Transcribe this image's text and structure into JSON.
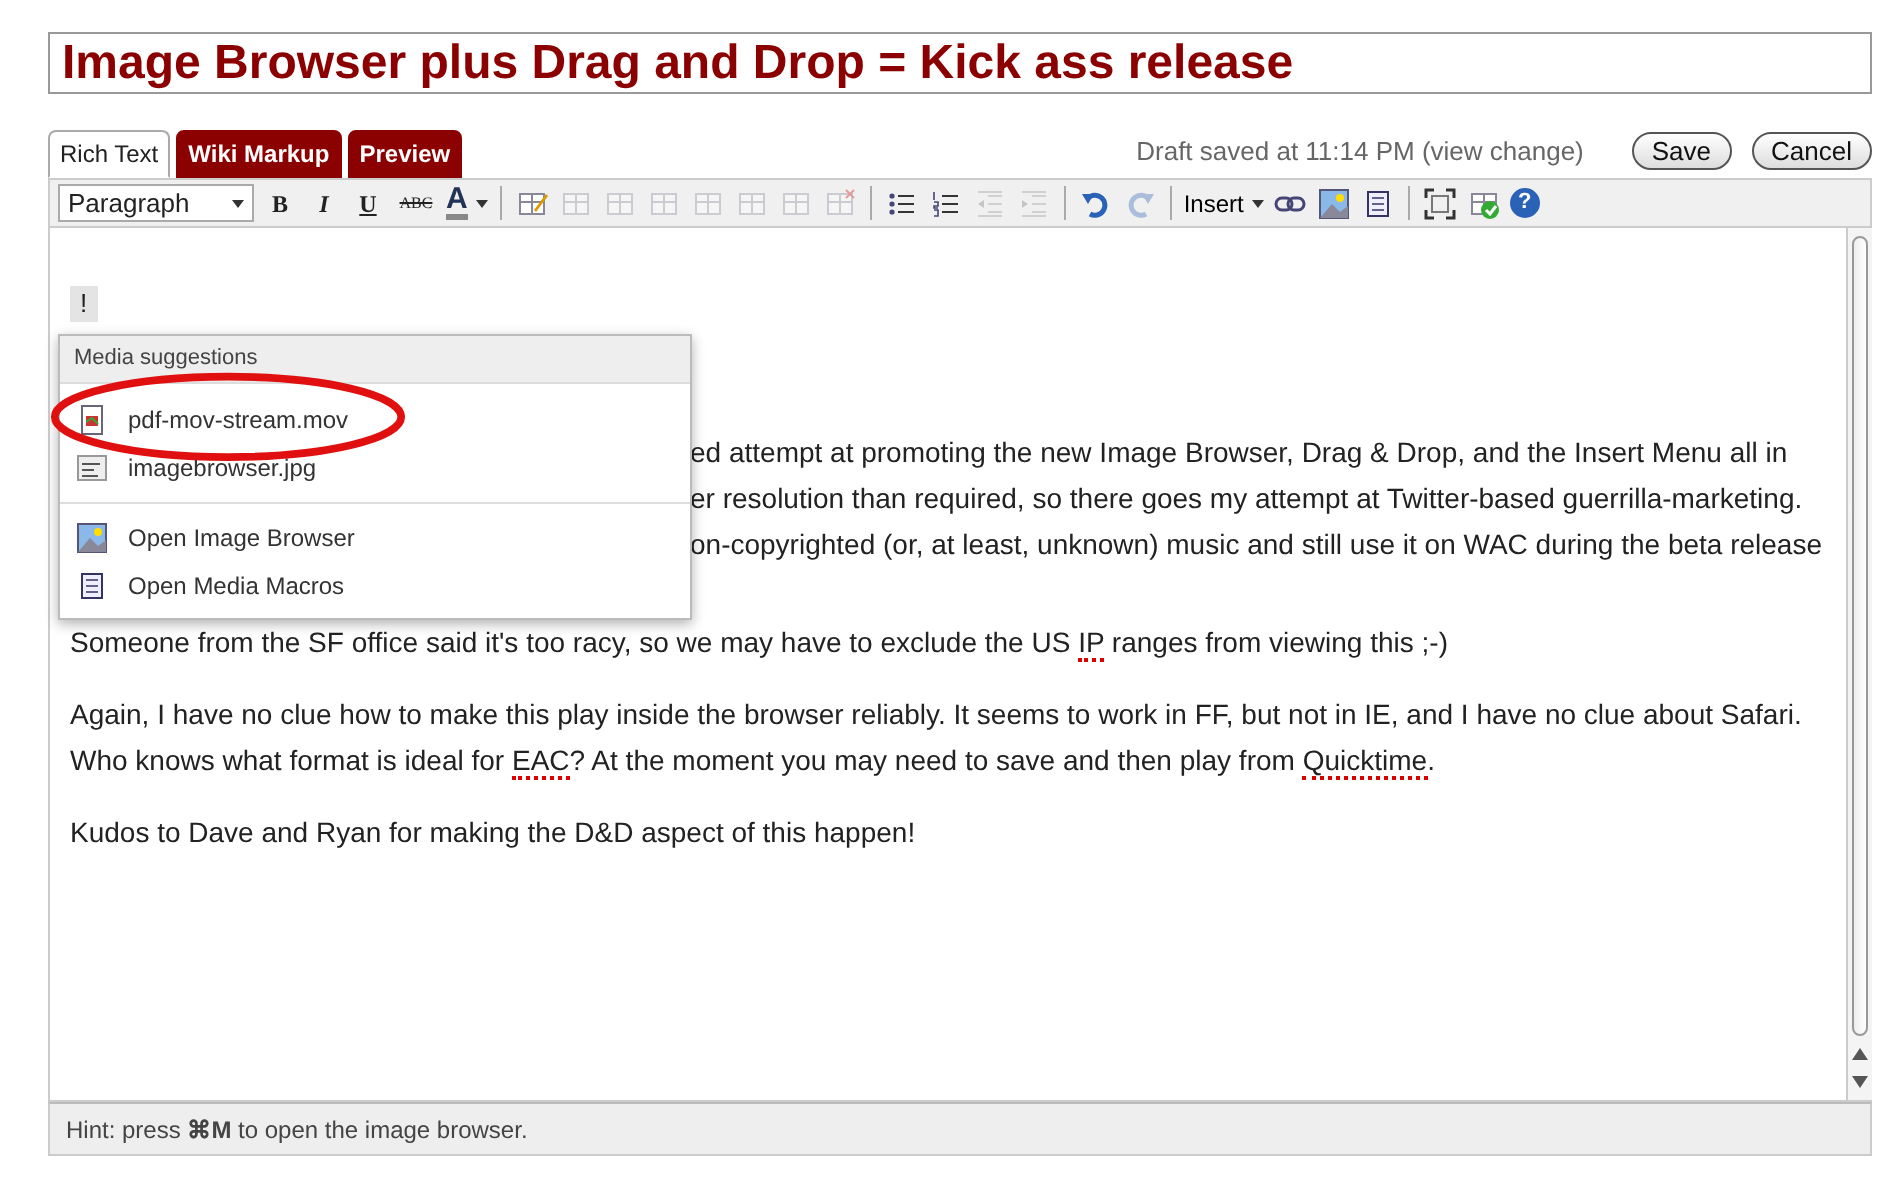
{
  "title": "Image Browser plus Drag and Drop = Kick ass release",
  "tabs": [
    {
      "label": "Rich Text",
      "selected": true
    },
    {
      "label": "Wiki Markup",
      "selected": false
    },
    {
      "label": "Preview",
      "selected": false
    }
  ],
  "draft_status": "Draft saved at 11:14 PM (view change)",
  "buttons": [
    "Save",
    "Cancel"
  ],
  "toolbar": [
    {
      "kind": "select",
      "label": "Paragraph"
    },
    {
      "kind": "bold",
      "label": "B"
    },
    {
      "kind": "italic",
      "label": "I"
    },
    {
      "kind": "underline",
      "label": "U"
    },
    {
      "kind": "strike",
      "label": "ABC"
    },
    {
      "kind": "color",
      "label": "A"
    },
    {
      "kind": "separator"
    },
    {
      "kind": "icon",
      "disabled": false
    },
    {
      "kind": "icon",
      "disabled": true
    },
    {
      "kind": "icon",
      "disabled": true
    },
    {
      "kind": "icon",
      "disabled": true
    },
    {
      "kind": "icon",
      "disabled": true
    },
    {
      "kind": "icon",
      "disabled": true
    },
    {
      "kind": "icon",
      "disabled": true
    },
    {
      "kind": "icon",
      "disabled": true
    },
    {
      "kind": "separator"
    },
    {
      "kind": "icon",
      "disabled": false
    },
    {
      "kind": "icon",
      "disabled": false
    },
    {
      "kind": "icon",
      "disabled": true
    },
    {
      "kind": "icon",
      "disabled": true
    },
    {
      "kind": "separator"
    },
    {
      "kind": "icon",
      "disabled": false
    },
    {
      "kind": "icon",
      "disabled": true
    },
    {
      "kind": "separator"
    },
    {
      "kind": "menu",
      "label": "Insert"
    },
    {
      "kind": "icon",
      "disabled": false
    },
    {
      "kind": "icon",
      "disabled": false
    },
    {
      "kind": "icon",
      "disabled": false
    },
    {
      "kind": "separator"
    },
    {
      "kind": "icon",
      "disabled": false
    },
    {
      "kind": "icon",
      "disabled": false
    },
    {
      "kind": "help",
      "label": "?"
    }
  ],
  "marker": "!",
  "media_popup": {
    "header": "Media suggestions",
    "items": [
      {
        "kind": "movie",
        "label": "pdf-mov-stream.mov"
      },
      {
        "kind": "image-file",
        "label": "imagebrowser.jpg"
      },
      {
        "kind": "divider"
      },
      {
        "kind": "image-browser",
        "label": "Open Image Browser"
      },
      {
        "kind": "macros",
        "label": "Open Media Macros"
      }
    ]
  },
  "covered_lines": [
    "ed attempt at promoting the new Image Browser, Drag & Drop, and the Insert Menu all in",
    "er resolution than required, so there goes my attempt at Twitter-based guerrilla-marketing.",
    "on-copyrighted (or, at least, unknown) music and still use it on WAC during the beta release"
  ],
  "paragraphs": [
    {
      "segments": [
        {
          "text": "Someone from the SF office said it's too racy, so we may have to exclude the US ",
          "misspelled": false
        },
        {
          "text": "IP",
          "misspelled": true
        },
        {
          "text": " ranges from viewing this ;-)",
          "misspelled": false
        }
      ]
    },
    {
      "segments": [
        {
          "text": "Again, I have no clue how to make this play inside the browser reliably. It seems to work in FF, but not in IE, and I have no clue about Safari. Who knows what format is ideal for ",
          "misspelled": false
        },
        {
          "text": "EAC",
          "misspelled": true
        },
        {
          "text": "? At the moment you may need to save and then play from ",
          "misspelled": false
        },
        {
          "text": "Quicktime",
          "misspelled": true
        },
        {
          "text": ".",
          "misspelled": false
        }
      ]
    },
    {
      "segments": [
        {
          "text": "Kudos to Dave and Ryan for making the D&D aspect of this happen!",
          "misspelled": false
        }
      ]
    }
  ],
  "hint": "Hint: press **⌘M** to open the image browser."
}
